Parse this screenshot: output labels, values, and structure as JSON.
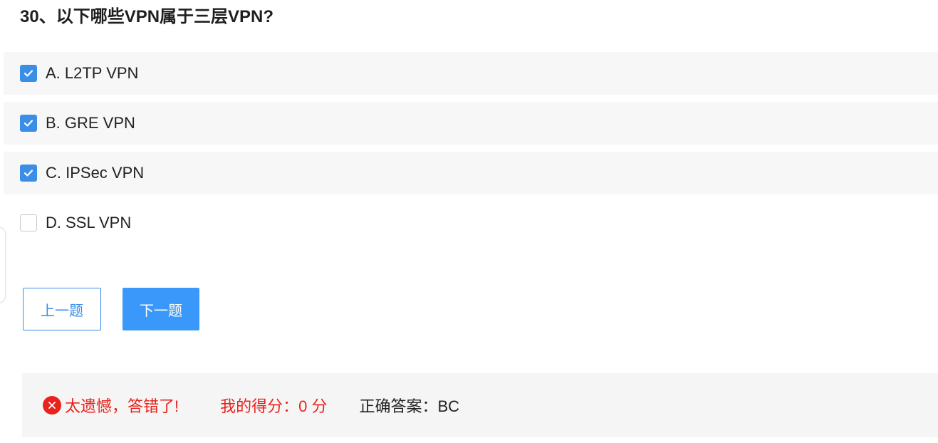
{
  "question": {
    "title": "30、以下哪些VPN属于三层VPN?"
  },
  "options": [
    {
      "label": "A. L2TP VPN",
      "checked": true
    },
    {
      "label": "B. GRE VPN",
      "checked": true
    },
    {
      "label": "C. IPSec VPN",
      "checked": true
    },
    {
      "label": "D. SSL VPN",
      "checked": false
    }
  ],
  "buttons": {
    "prev_label": "上一题",
    "next_label": "下一题"
  },
  "result": {
    "status_text": "太遗憾，答错了!",
    "status_icon": "wrong-circle-icon",
    "score_text": "我的得分：0 分",
    "answer_text": "正确答案：BC"
  },
  "colors": {
    "primary": "#3a98fa",
    "checkbox_checked": "#3a8ee6",
    "error": "#e8231d",
    "option_background": "#f7f7f7",
    "result_background": "#f5f5f5"
  }
}
